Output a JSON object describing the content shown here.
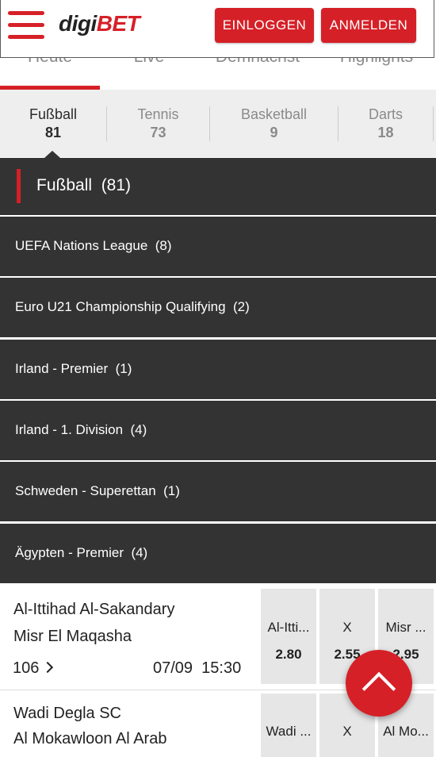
{
  "header": {
    "logo_part1": "digi",
    "logo_part2": "BET",
    "login_label": "EINLOGGEN",
    "register_label": "ANMELDEN",
    "nav_tabs": [
      "Heute",
      "Live",
      "Demnächst",
      "Highlights"
    ]
  },
  "sport_tabs": [
    {
      "name": "Fußball",
      "count": "81",
      "active": true
    },
    {
      "name": "Tennis",
      "count": "73",
      "active": false
    },
    {
      "name": "Basketball",
      "count": "9",
      "active": false
    },
    {
      "name": "Darts",
      "count": "18",
      "active": false
    }
  ],
  "section": {
    "title": "Fußball  (81)"
  },
  "leagues": [
    "UEFA Nations League  (8)",
    "Euro U21 Championship Qualifying  (2)",
    "Irland - Premier  (1)",
    "Irland - 1. Division  (4)",
    "Schweden - Superettan  (1)",
    "Ägypten - Premier  (4)"
  ],
  "matches": [
    {
      "home": "Al-Ittihad Al-Sakandary",
      "away": "Misr El Maqasha",
      "markets": "106",
      "datetime": "07/09  15:30",
      "odds": [
        {
          "label": "Al-Itti...",
          "value": "2.80"
        },
        {
          "label": "X",
          "value": "2.55"
        },
        {
          "label": "Misr ...",
          "value": "2.95"
        }
      ]
    },
    {
      "home": "Wadi Degla SC",
      "away": "Al Mokawloon Al Arab",
      "markets": "",
      "datetime": "",
      "odds": [
        {
          "label": "Wadi ...",
          "value": ""
        },
        {
          "label": "X",
          "value": ""
        },
        {
          "label": "Al Mo...",
          "value": ""
        }
      ]
    }
  ],
  "colors": {
    "accent": "#d62027",
    "dark_row": "#333333",
    "tabs_bg": "#eeeeee"
  },
  "icons": {
    "menu": "hamburger-menu-icon",
    "scroll_top": "chevron-up-icon",
    "markets": "chevron-right-icon"
  }
}
